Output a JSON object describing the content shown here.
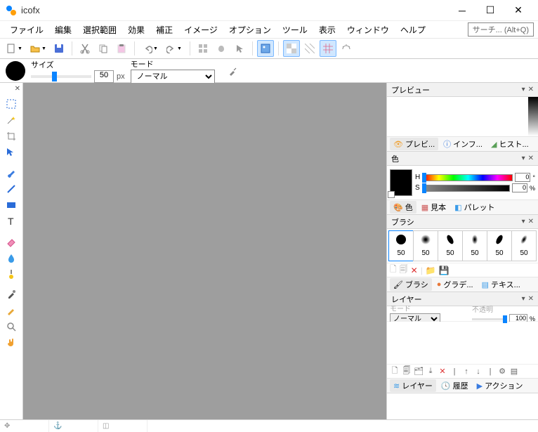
{
  "titlebar": {
    "title": "icofx"
  },
  "menu": {
    "file": "ファイル",
    "edit": "編集",
    "selection": "選択範囲",
    "effect": "効果",
    "adjust": "補正",
    "image": "イメージ",
    "options": "オプション",
    "tools": "ツール",
    "view": "表示",
    "window": "ウィンドウ",
    "help": "ヘルプ"
  },
  "search": {
    "placeholder": "サーチ... (Alt+Q)"
  },
  "brushbar": {
    "size_label": "サイズ",
    "size_value": "50",
    "size_unit": "px",
    "mode_label": "モード",
    "mode_value": "ノーマル"
  },
  "preview": {
    "title": "プレビュー",
    "tabs": {
      "preview": "プレビ...",
      "info": "インフ...",
      "histogram": "ヒスト..."
    }
  },
  "color": {
    "title": "色",
    "h_label": "H",
    "s_label": "S",
    "h_value": "0",
    "s_value": "0",
    "s_unit": "%",
    "h_unit": "°",
    "tabs": {
      "color": "色",
      "swatch": "見本",
      "palette": "パレット"
    }
  },
  "brush": {
    "title": "ブラシ",
    "sizes": [
      "50",
      "50",
      "50",
      "50",
      "50",
      "50"
    ],
    "tabs": {
      "brush": "ブラシ",
      "gradient": "グラデ...",
      "texture": "テキス..."
    }
  },
  "layer": {
    "title": "レイヤー",
    "mode_label": "モード",
    "mode_value": "ノーマル",
    "opacity_label": "不透明",
    "opacity_value": "100",
    "opacity_unit": "%",
    "tabs": {
      "layer": "レイヤー",
      "history": "履歴",
      "action": "アクション"
    }
  }
}
